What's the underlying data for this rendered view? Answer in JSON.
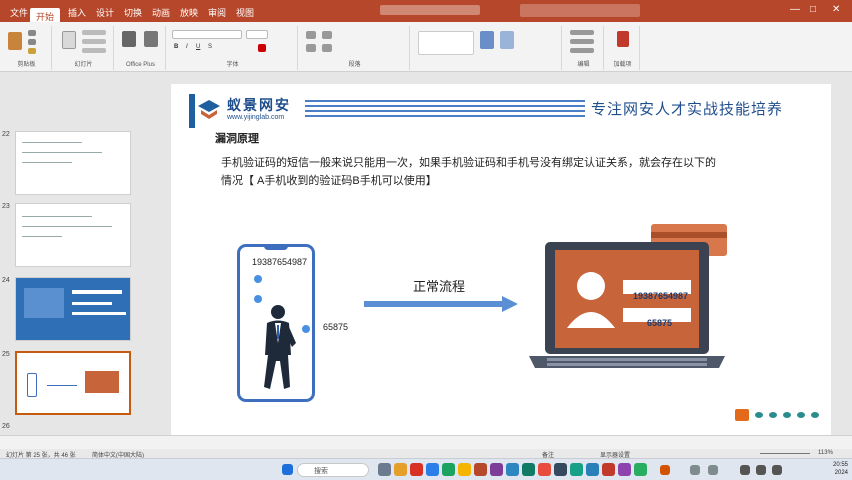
{
  "titlebar": {
    "tabs": [
      "文件",
      "开始",
      "插入",
      "设计",
      "切换",
      "动画",
      "放映",
      "审阅",
      "视图"
    ],
    "active_tab": "开始"
  },
  "ribbon": {
    "groups": [
      "剪贴板",
      "幻灯片",
      "Office Plus",
      "字体",
      "段落",
      "编辑",
      "加载项"
    ]
  },
  "thumbnails": [
    {
      "num": "22",
      "selected": false
    },
    {
      "num": "23",
      "selected": false
    },
    {
      "num": "24",
      "selected": false
    },
    {
      "num": "25",
      "selected": true
    },
    {
      "num": "26",
      "selected": false
    }
  ],
  "slide": {
    "brand": "蚁景网安",
    "brand_url": "www.yijinglab.com",
    "slogan": "专注网安人才实战技能培养",
    "section_title": "漏洞原理",
    "body_line1": "手机验证码的短信一般来说只能用一次，如果手机验证码和手机号没有绑定认证关系，就会存在以下的",
    "body_line2": "情况【 A手机收到的验证码B手机可以使用】",
    "phone_number": "19387654987",
    "sms_code": "65875",
    "flow_label": "正常流程",
    "laptop_phone": "19387654987",
    "laptop_code": "65875"
  },
  "statusbar": {
    "left": "幻灯片 第 25 张，共 46 张",
    "language": "简体中文(中国大陆)",
    "notes": "备注",
    "display": "显示器设置",
    "zoom": "113%"
  },
  "taskbar": {
    "search_placeholder": "搜索",
    "time": "20:55",
    "date": "2024"
  },
  "colors": {
    "ppt_red": "#b7472a",
    "brand_blue": "#1f4e8c",
    "laptop_orange": "#c8643a",
    "selection": "#c55a11"
  }
}
